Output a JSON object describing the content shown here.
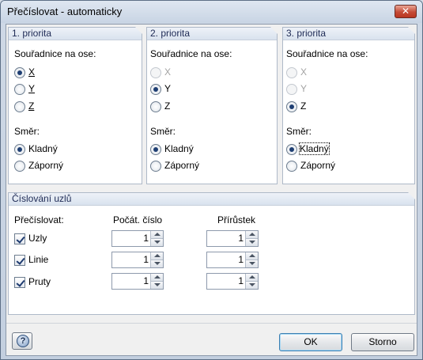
{
  "window": {
    "title": "Přečíslovat - automaticky",
    "close_glyph": "✕"
  },
  "priorities": [
    {
      "header": "1. priorita",
      "axis_label": "Souřadnice na ose:",
      "axis_options": [
        "X",
        "Y",
        "Z"
      ],
      "axis_selected": "X",
      "disabled_options": [],
      "direction_label": "Směr:",
      "direction_options": [
        "Kladný",
        "Záporný"
      ],
      "direction_selected": "Kladný"
    },
    {
      "header": "2. priorita",
      "axis_label": "Souřadnice na ose:",
      "axis_options": [
        "X",
        "Y",
        "Z"
      ],
      "axis_selected": "Y",
      "disabled_options": [
        "X"
      ],
      "direction_label": "Směr:",
      "direction_options": [
        "Kladný",
        "Záporný"
      ],
      "direction_selected": "Kladný"
    },
    {
      "header": "3. priorita",
      "axis_label": "Souřadnice na ose:",
      "axis_options": [
        "X",
        "Y",
        "Z"
      ],
      "axis_selected": "Z",
      "disabled_options": [
        "X",
        "Y"
      ],
      "direction_label": "Směr:",
      "direction_options": [
        "Kladný",
        "Záporný"
      ],
      "direction_selected": "Kladný"
    }
  ],
  "numbering": {
    "header": "Číslování uzlů",
    "col_renumber": "Přečíslovat:",
    "col_start": "Počát. číslo",
    "col_increment": "Přírůstek",
    "rows": [
      {
        "label": "Uzly",
        "checked": true,
        "start": "1",
        "increment": "1"
      },
      {
        "label": "Linie",
        "checked": true,
        "start": "1",
        "increment": "1"
      },
      {
        "label": "Pruty",
        "checked": true,
        "start": "1",
        "increment": "1"
      }
    ]
  },
  "buttons": {
    "ok": "OK",
    "cancel": "Storno",
    "help_icon": "help-icon"
  },
  "colors": {
    "title_bar": "#c8d4e4",
    "panel_header_text": "#1e2a55",
    "close_button": "#c54b36",
    "default_button_border": "#3c7fb1"
  }
}
